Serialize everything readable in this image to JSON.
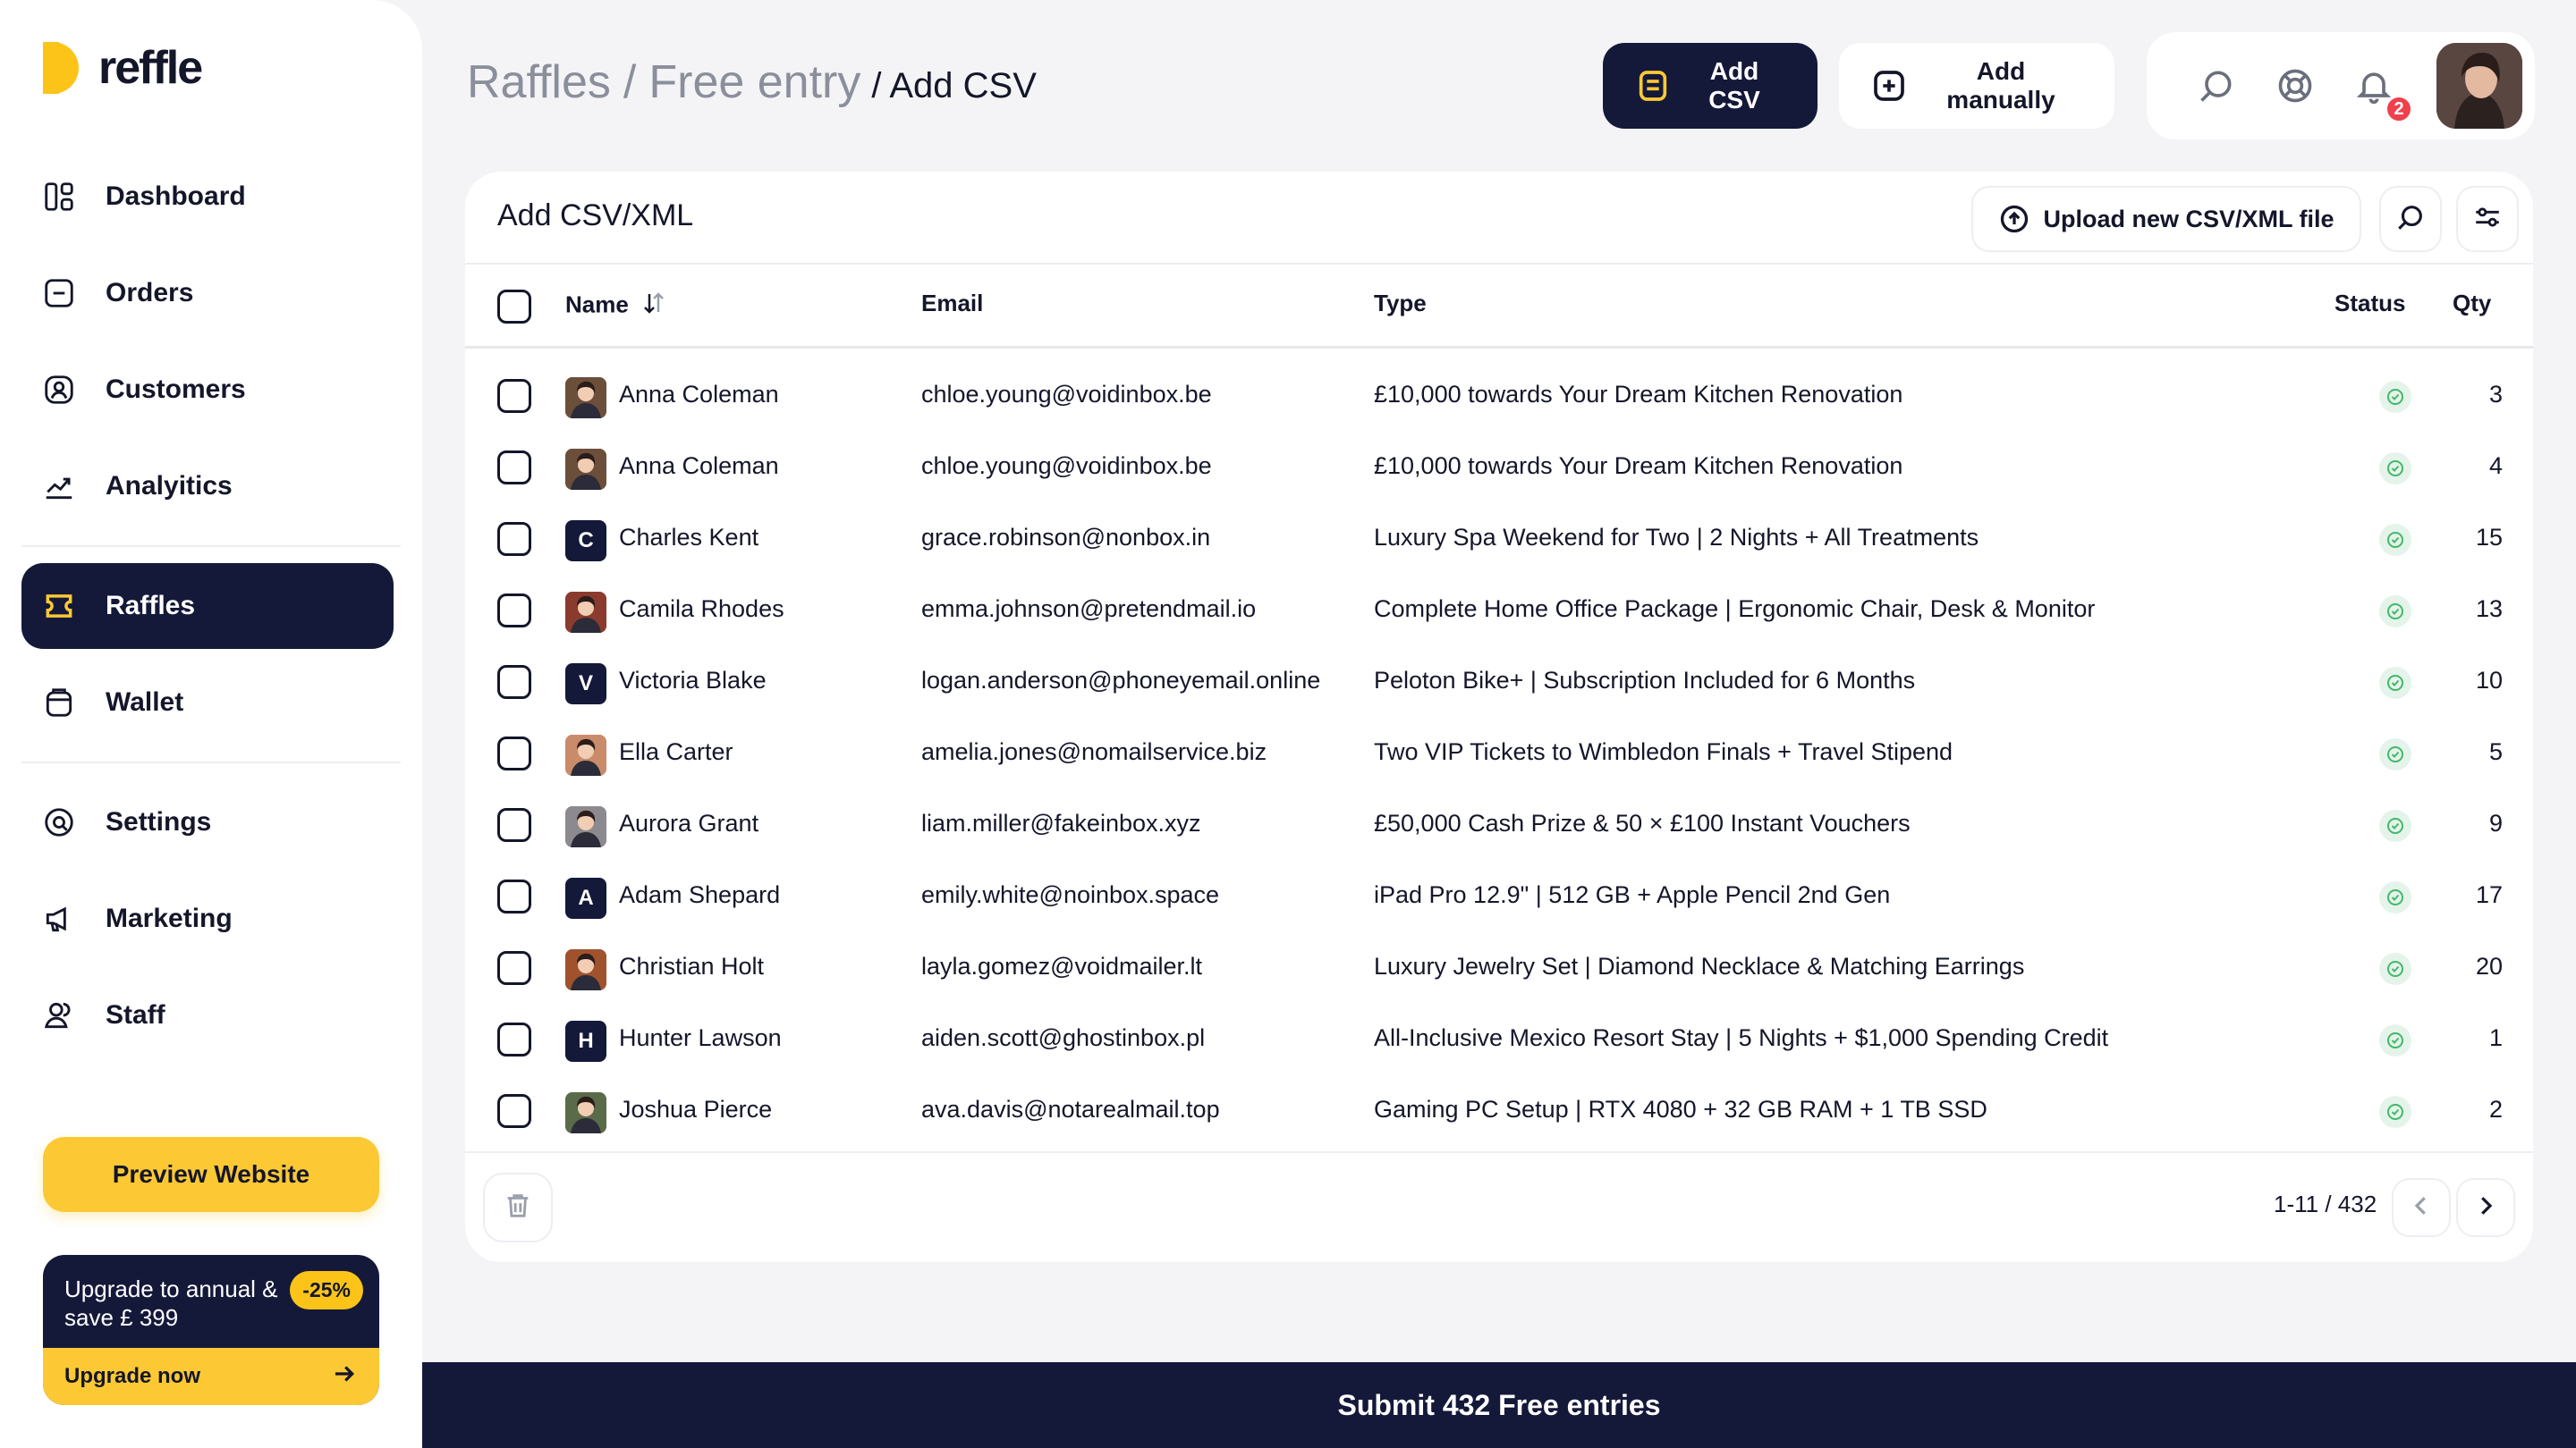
{
  "app": {
    "logo_text": "reffle"
  },
  "sidebar": {
    "items": [
      {
        "label": "Dashboard",
        "icon": "dashboard-icon"
      },
      {
        "label": "Orders",
        "icon": "orders-icon"
      },
      {
        "label": "Customers",
        "icon": "customers-icon"
      },
      {
        "label": "Analyitics",
        "icon": "analytics-icon"
      },
      {
        "label": "Raffles",
        "icon": "raffles-icon",
        "active": true
      },
      {
        "label": "Wallet",
        "icon": "wallet-icon"
      },
      {
        "label": "Settings",
        "icon": "settings-icon"
      },
      {
        "label": "Marketing",
        "icon": "megaphone-icon"
      },
      {
        "label": "Staff",
        "icon": "staff-icon"
      }
    ],
    "preview_label": "Preview Website",
    "upgrade": {
      "text": "Upgrade to annual & save £ 399",
      "badge": "-25%",
      "cta": "Upgrade now"
    }
  },
  "header": {
    "breadcrumb": [
      "Raffles",
      "Free entry"
    ],
    "current": "/ Add CSV",
    "add_csv_label": "Add CSV",
    "add_manually_label": "Add manually",
    "notification_count": "2"
  },
  "card": {
    "title": "Add CSV/XML",
    "upload_label": "Upload new CSV/XML file",
    "columns": {
      "name": "Name",
      "email": "Email",
      "type": "Type",
      "status": "Status",
      "qty": "Qty"
    },
    "rows": [
      {
        "name": "Anna Coleman",
        "email": "chloe.young@voidinbox.be",
        "type": "£10,000 towards Your Dream Kitchen Renovation",
        "qty": "3",
        "avatar": "photo",
        "color": "#6b4f3a"
      },
      {
        "name": "Anna Coleman",
        "email": "chloe.young@voidinbox.be",
        "type": "£10,000 towards Your Dream Kitchen Renovation",
        "qty": "4",
        "avatar": "photo",
        "color": "#6b4f3a"
      },
      {
        "name": "Charles Kent",
        "email": "grace.robinson@nonbox.in",
        "type": "Luxury Spa Weekend for Two | 2 Nights + All Treatments",
        "qty": "15",
        "avatar": "C",
        "color": "#14193a"
      },
      {
        "name": "Camila Rhodes",
        "email": "emma.johnson@pretendmail.io",
        "type": "Complete Home Office Package | Ergonomic Chair, Desk & Monitor",
        "qty": "13",
        "avatar": "photo",
        "color": "#8a3b2e"
      },
      {
        "name": "Victoria Blake",
        "email": "logan.anderson@phoneyemail.online",
        "type": "Peloton Bike+ | Subscription Included for 6 Months",
        "qty": "10",
        "avatar": "V",
        "color": "#14193a"
      },
      {
        "name": "Ella Carter",
        "email": "amelia.jones@nomailservice.biz",
        "type": "Two VIP Tickets to Wimbledon Finals + Travel Stipend",
        "qty": "5",
        "avatar": "photo",
        "color": "#c98b6a"
      },
      {
        "name": "Aurora Grant",
        "email": "liam.miller@fakeinbox.xyz",
        "type": "£50,000 Cash Prize & 50 × £100 Instant Vouchers",
        "qty": "9",
        "avatar": "photo",
        "color": "#8d8a8f"
      },
      {
        "name": "Adam Shepard",
        "email": "emily.white@noinbox.space",
        "type": "iPad Pro 12.9\" | 512 GB + Apple Pencil 2nd Gen",
        "qty": "17",
        "avatar": "A",
        "color": "#14193a"
      },
      {
        "name": "Christian Holt",
        "email": "layla.gomez@voidmailer.lt",
        "type": "Luxury Jewelry Set | Diamond Necklace & Matching Earrings",
        "qty": "20",
        "avatar": "photo",
        "color": "#a0522d"
      },
      {
        "name": "Hunter Lawson",
        "email": "aiden.scott@ghostinbox.pl",
        "type": "All-Inclusive Mexico Resort Stay | 5 Nights + $1,000 Spending Credit",
        "qty": "1",
        "avatar": "H",
        "color": "#14193a"
      },
      {
        "name": "Joshua Pierce",
        "email": "ava.davis@notarealmail.top",
        "type": "Gaming PC Setup | RTX 4080 + 32 GB RAM + 1 TB SSD",
        "qty": "2",
        "avatar": "photo",
        "color": "#5a6b4a"
      }
    ],
    "pagination": "1-11 / 432"
  },
  "submit_label": "Submit 432 Free entries",
  "colors": {
    "navy": "#14193a",
    "yellow": "#fcc934",
    "success": "#43b86a",
    "danger": "#f0404b"
  }
}
